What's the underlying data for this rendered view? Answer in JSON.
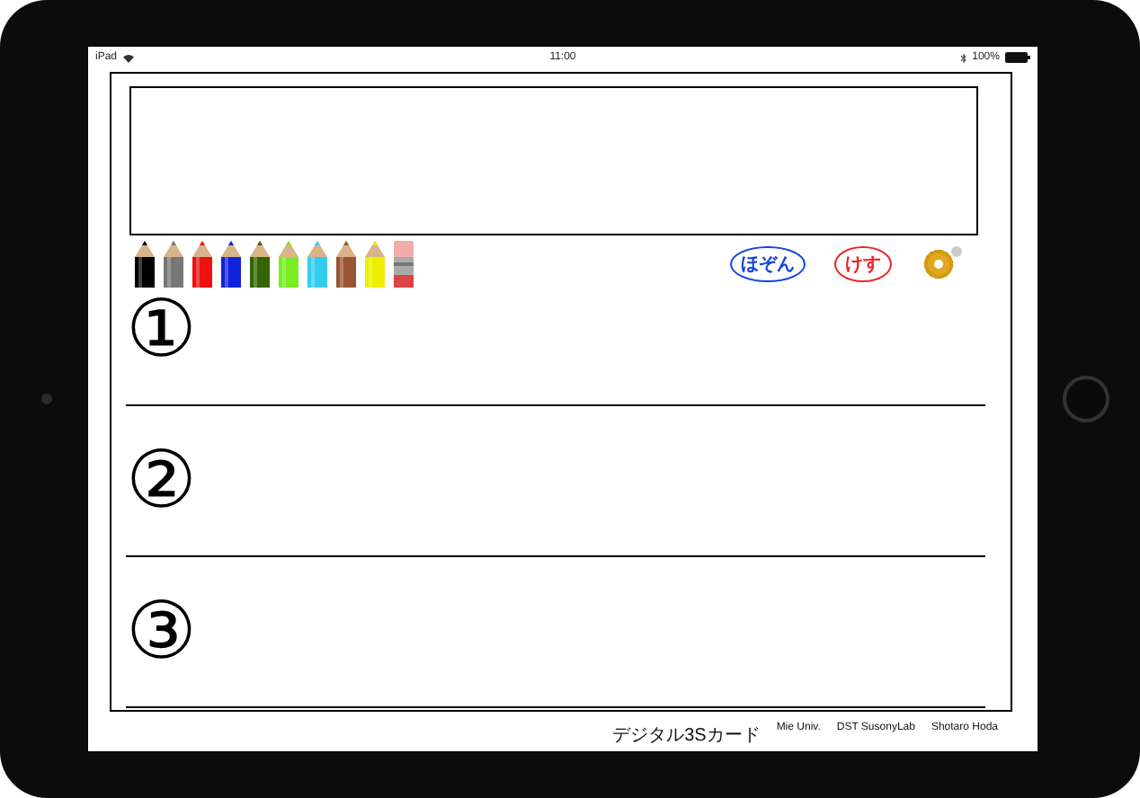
{
  "status_bar": {
    "carrier": "iPad",
    "time": "11:00",
    "battery": "100%"
  },
  "pencils": [
    {
      "kind": "pencil",
      "color": "#000000"
    },
    {
      "kind": "pencil",
      "color": "#777777"
    },
    {
      "kind": "pencil",
      "color": "#ee1111"
    },
    {
      "kind": "pencil",
      "color": "#1122dd"
    },
    {
      "kind": "pencil",
      "color": "#336600"
    },
    {
      "kind": "pencil",
      "color": "#77ee22"
    },
    {
      "kind": "pencil",
      "color": "#33ccee"
    },
    {
      "kind": "pencil",
      "color": "#995533"
    },
    {
      "kind": "pencil",
      "color": "#eeee00"
    },
    {
      "kind": "eraser",
      "color": "#dd4444"
    }
  ],
  "buttons": [
    {
      "label": "ほぞん",
      "color": "#1144dd"
    },
    {
      "label": "けす",
      "color": "#ee2222"
    }
  ],
  "sections": [
    {
      "number": "①"
    },
    {
      "number": "②"
    },
    {
      "number": "③"
    }
  ],
  "footer": [
    "デジタル3Sカード",
    "Mie Univ.",
    "DST SusonyLab",
    "Shotaro Hoda"
  ]
}
